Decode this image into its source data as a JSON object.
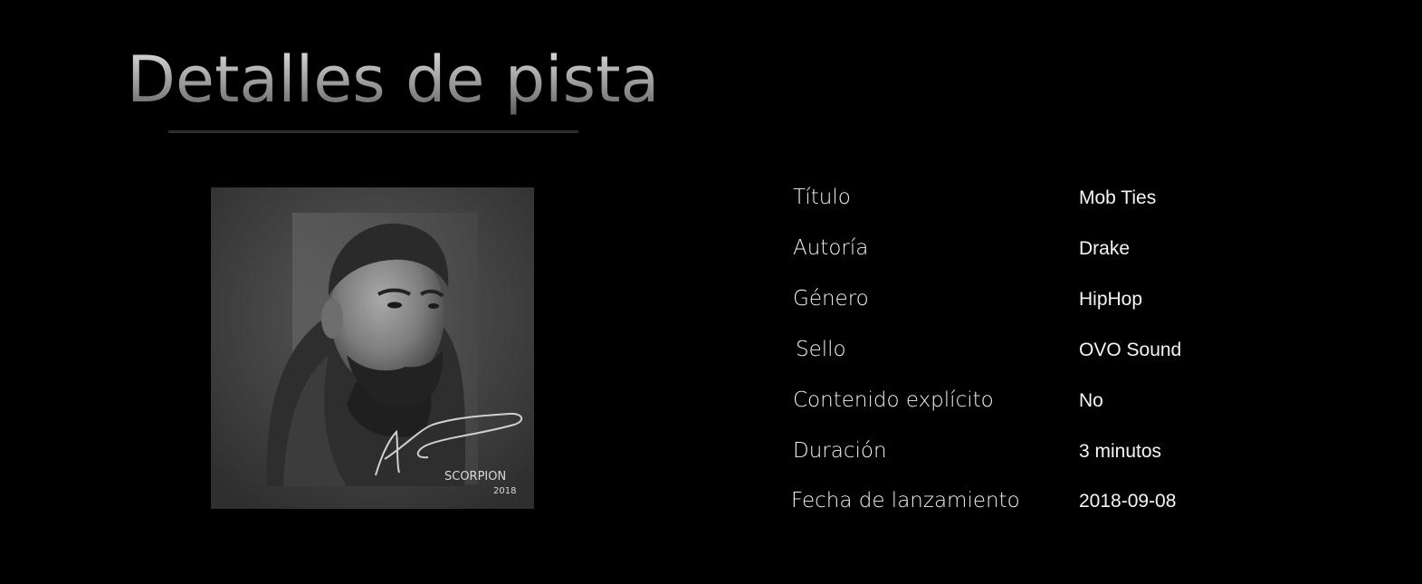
{
  "page": {
    "title": "Detalles de pista"
  },
  "album": {
    "art_icon": "album-cover-image",
    "art_text_line1": "SCORPION",
    "art_text_line2": "2018"
  },
  "details": {
    "rows": [
      {
        "label": "Título",
        "value": "Mob Ties"
      },
      {
        "label": "Autoría",
        "value": "Drake"
      },
      {
        "label": "Género",
        "value": "HipHop"
      },
      {
        "label": "Sello",
        "value": "OVO Sound"
      },
      {
        "label": "Contenido explícito",
        "value": "No"
      },
      {
        "label": "Duración",
        "value": "3 minutos"
      },
      {
        "label": "Fecha de lanzamiento",
        "value": "2018-09-08"
      }
    ]
  },
  "colors": {
    "background": "#000000",
    "text": "#ffffff"
  }
}
